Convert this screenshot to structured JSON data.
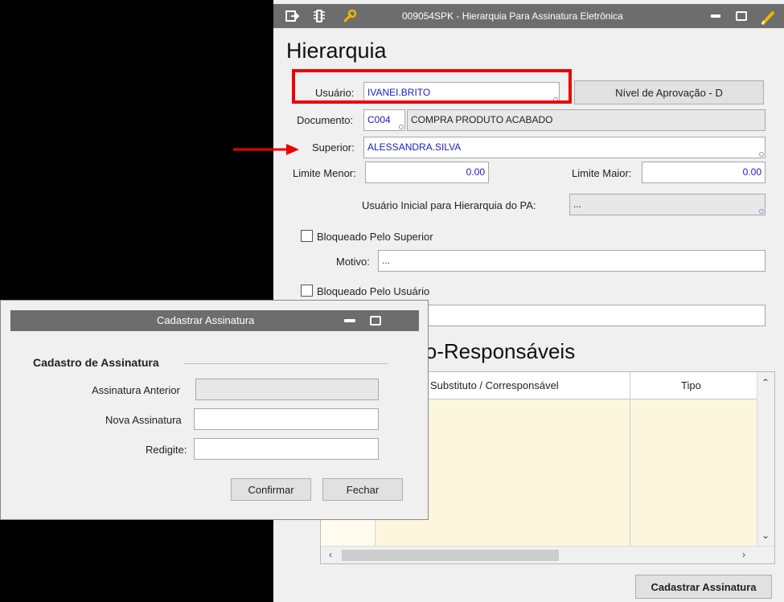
{
  "window": {
    "title": "009054SPK - Hierarquia Para Assinatura Eletrônica"
  },
  "page_title": "Hierarquia",
  "form": {
    "usuario_label": "Usuário:",
    "usuario_value": "IVANEI.BRITO",
    "nivel_button": "Nível de Aprovação - D",
    "documento_label": "Documento:",
    "documento_code": "C004",
    "documento_desc": "COMPRA PRODUTO ACABADO",
    "superior_label": "Superior:",
    "superior_value": "ALESSANDRA.SILVA",
    "limite_menor_label": "Limite Menor:",
    "limite_menor_value": "0.00",
    "limite_maior_label": "Limite Maior:",
    "limite_maior_value": "0.00",
    "usuario_inicial_label": "Usuário Inicial para Hierarquia do PA:",
    "usuario_inicial_value": "...",
    "bloq_superior_label": "Bloqueado Pelo Superior",
    "motivo_label": "Motivo:",
    "motivo_value": "...",
    "bloq_usuario_label": "Bloqueado Pelo Usuário",
    "motivo2_value": ""
  },
  "co_section_title": "Co-Responsáveis",
  "grid": {
    "columns": [
      "Substituto / Corresponsável",
      "Tipo"
    ]
  },
  "cadastrar_button": "Cadastrar Assinatura",
  "dialog": {
    "title": "Cadastrar Assinatura",
    "group_title": "Cadastro de  Assinatura",
    "anterior_label": "Assinatura Anterior",
    "nova_label": "Nova Assinatura",
    "redigite_label": "Redigite:",
    "anterior_value": "",
    "nova_value": "",
    "redigite_value": "",
    "confirm_button": "Confirmar",
    "close_button": "Fechar"
  },
  "colors": {
    "titlebar": "#6d6d6d",
    "highlight": "#ee0000",
    "field_text": "#1b1bcc",
    "grid_body": "#fdf6df"
  }
}
